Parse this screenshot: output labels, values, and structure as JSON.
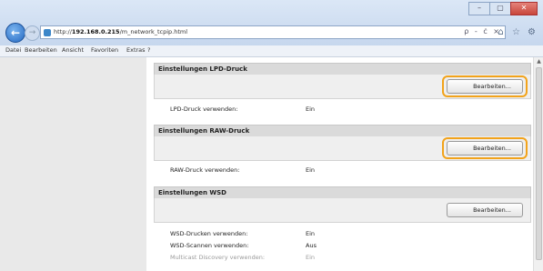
{
  "browser": {
    "url_prefix": "http://",
    "url_host": "192.168.0.215",
    "url_path": "/m_network_tcpip.html",
    "address_tools": "ρ - ċ ×",
    "window_buttons": [
      "–",
      "▢",
      "✕"
    ]
  },
  "menu": [
    "Datei",
    "Bearbeiten",
    "Ansicht",
    "Favoriten",
    "Extras",
    "?"
  ],
  "sections": [
    {
      "title": "Einstellungen LPD-Druck",
      "button": "Bearbeiten...",
      "highlighted": true,
      "rows": [
        {
          "label": "LPD-Druck verwenden:",
          "value": "Ein"
        }
      ]
    },
    {
      "title": "Einstellungen RAW-Druck",
      "button": "Bearbeiten...",
      "highlighted": true,
      "rows": [
        {
          "label": "RAW-Druck verwenden:",
          "value": "Ein"
        }
      ]
    },
    {
      "title": "Einstellungen WSD",
      "button": "Bearbeiten...",
      "highlighted": false,
      "rows": [
        {
          "label": "WSD-Drucken verwenden:",
          "value": "Ein"
        },
        {
          "label": "WSD-Scannen verwenden:",
          "value": "Aus"
        },
        {
          "label": "Multicast Discovery verwenden:",
          "value": "Ein"
        }
      ]
    }
  ],
  "colors": {
    "highlight": "#f2a31b",
    "section_header": "#dadada",
    "left_panel": "#e9e9e9"
  }
}
